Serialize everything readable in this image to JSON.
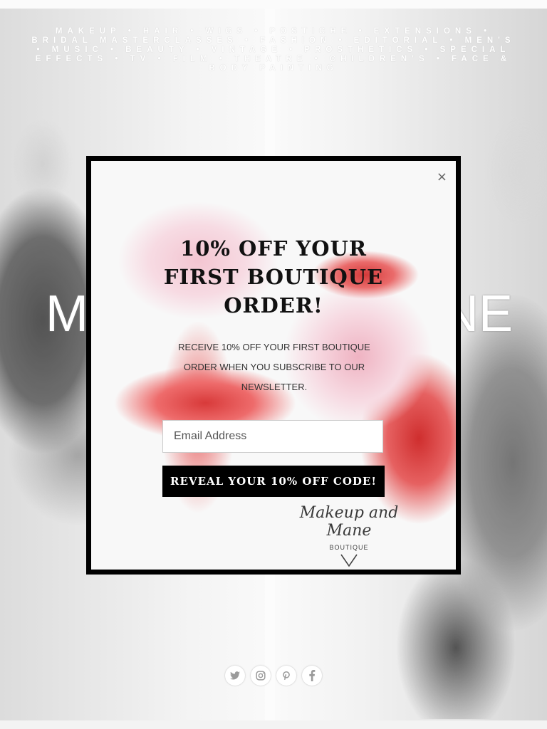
{
  "background": {
    "services_text": "MAKEUP • HAIR • WIGS • POSTICHE • EXTENSIONS • BRIDAL MASTERCLASSES • FASHION • EDITORIAL • MEN'S • MUSIC • BEAUTY • VINTAGE • PROSTHETICS • SPECIAL EFFECTS • TV • FILM • THEATRE • CHILDREN'S • FACE & BODY PAINTING",
    "brand_left": "M",
    "brand_right": "NE"
  },
  "social": {
    "icons": [
      "twitter-icon",
      "instagram-icon",
      "pinterest-icon",
      "facebook-icon"
    ]
  },
  "popup": {
    "close_label": "×",
    "title": "10% OFF YOUR FIRST BOUTIQUE ORDER!",
    "description": "RECEIVE 10% OFF YOUR FIRST BOUTIQUE ORDER WHEN YOU SUBSCRIBE TO OUR NEWSLETTER.",
    "email_placeholder": "Email Address",
    "submit_label": "REVEAL YOUR 10% OFF CODE!",
    "logo_script": "Makeup and Mane",
    "logo_sub": "BOUTIQUE"
  },
  "colors": {
    "accent_red": "#d43a3a",
    "button": "#000000"
  }
}
